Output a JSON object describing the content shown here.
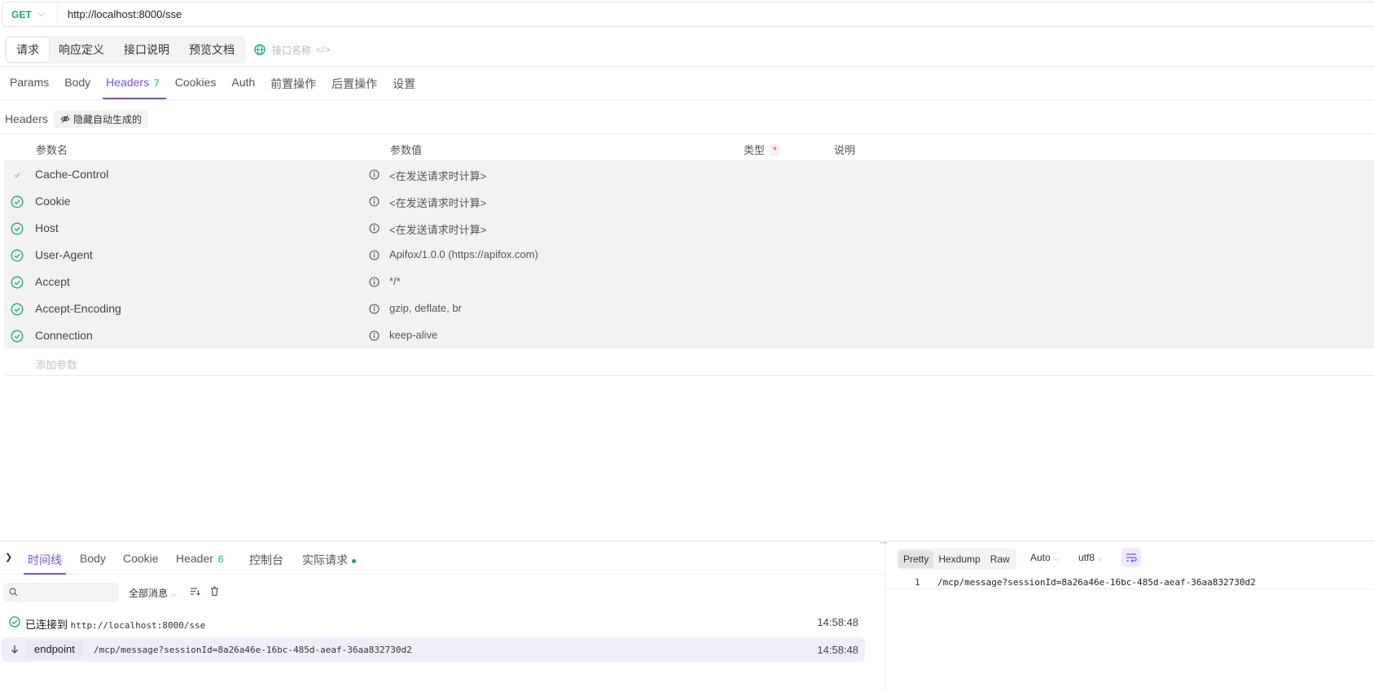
{
  "request": {
    "method": "GET",
    "url": "http://localhost:8000/sse"
  },
  "top_tabs": [
    "请求",
    "响应定义",
    "接口说明",
    "预览文档"
  ],
  "api_name_placeholder": "接口名称",
  "sub_tabs": {
    "params": "Params",
    "body": "Body",
    "headers": "Headers",
    "headers_count": "7",
    "cookies": "Cookies",
    "auth": "Auth",
    "pre_ops": "前置操作",
    "post_ops": "后置操作",
    "settings": "设置"
  },
  "headers_section": {
    "label": "Headers",
    "hide_auto_label": "隐藏自动生成的"
  },
  "table": {
    "col_name": "参数名",
    "col_value": "参数值",
    "col_type": "类型",
    "col_type_required": "*",
    "col_desc": "说明",
    "rows": [
      {
        "name": "Cache-Control",
        "value": "<在发送请求时计算>"
      },
      {
        "name": "Cookie",
        "value": "<在发送请求时计算>"
      },
      {
        "name": "Host",
        "value": "<在发送请求时计算>"
      },
      {
        "name": "User-Agent",
        "value": "Apifox/1.0.0 (https://apifox.com)"
      },
      {
        "name": "Accept",
        "value": "*/*"
      },
      {
        "name": "Accept-Encoding",
        "value": "gzip, deflate, br"
      },
      {
        "name": "Connection",
        "value": "keep-alive"
      }
    ],
    "add_placeholder": "添加参数"
  },
  "response": {
    "tabs": {
      "timeline": "时间线",
      "body": "Body",
      "cookie": "Cookie",
      "header": "Header",
      "header_count": "6",
      "console": "控制台",
      "actual": "实际请求"
    },
    "filter_all": "全部消息",
    "events": [
      {
        "label": "已连接到",
        "data": "http://localhost:8000/sse",
        "time": "14:58:48"
      },
      {
        "label": "endpoint",
        "data": "/mcp/message?sessionId=8a26a46e-16bc-485d-aeaf-36aa832730d2",
        "time": "14:58:48"
      }
    ],
    "view_modes": [
      "Pretty",
      "Hexdump",
      "Raw"
    ],
    "format": "Auto",
    "encoding": "utf8",
    "code_line_number": "1",
    "code_content": "/mcp/message?sessionId=8a26a46e-16bc-485d-aeaf-36aa832730d2"
  },
  "colors": {
    "accent": "#7a4fe6",
    "success": "#17a86b"
  }
}
